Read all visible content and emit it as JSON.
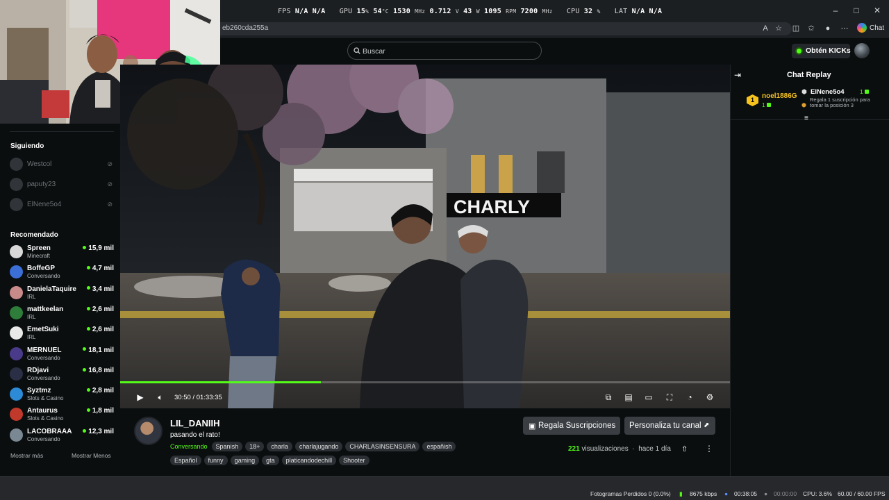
{
  "perf_overlay": {
    "fps_label": "FPS",
    "fps_values": "N/A N/A",
    "gpu_label": "GPU",
    "gpu_load": "15",
    "gpu_load_unit": "%",
    "gpu_temp": "54",
    "gpu_temp_unit": "°C",
    "gpu_clock": "1530",
    "gpu_clock_unit": "MHz",
    "gpu_voltage": "0.712",
    "gpu_voltage_unit": "V",
    "gpu_power": "43",
    "gpu_power_unit": "W",
    "fan_rpm": "1095",
    "fan_rpm_unit": "RPM",
    "mem_clock": "7200",
    "mem_clock_unit": "MHz",
    "cpu_label": "CPU",
    "cpu_load": "32",
    "cpu_load_unit": "%",
    "lat_label": "LAT",
    "lat_values": "N/A N/A"
  },
  "browser": {
    "url": "eb260cda255a",
    "chat_label": "Chat"
  },
  "header": {
    "search_placeholder": "Buscar",
    "kicks_button": "Obtén KICKs"
  },
  "video_overlay_text": {
    "shop_sign": "CHARLY"
  },
  "sidebar": {
    "following_title": "Siguiendo",
    "following": [
      {
        "name": "Westcol"
      },
      {
        "name": "paputy23"
      },
      {
        "name": "ElNene5o4"
      }
    ],
    "recommended_title": "Recomendado",
    "recommended": [
      {
        "name": "Spreen",
        "category": "Minecraft",
        "viewers": "15,9 mil",
        "color": "#d8d8d8"
      },
      {
        "name": "BoffeGP",
        "category": "Conversando",
        "viewers": "4,7 mil",
        "color": "#3b6fd6"
      },
      {
        "name": "DanielaTaquire",
        "category": "IRL",
        "viewers": "3,4 mil",
        "color": "#c98a8a"
      },
      {
        "name": "mattkeelan",
        "category": "IRL",
        "viewers": "2,6 mil",
        "color": "#2e7d3a"
      },
      {
        "name": "EmetSuki",
        "category": "IRL",
        "viewers": "2,6 mil",
        "color": "#e9e9e9"
      },
      {
        "name": "MERNUEL",
        "category": "Conversando",
        "viewers": "18,1 mil",
        "color": "#4a3a8a"
      },
      {
        "name": "RDjavi",
        "category": "Conversando",
        "viewers": "16,8 mil",
        "color": "#2a2f45"
      },
      {
        "name": "Syztmz",
        "category": "Slots & Casino",
        "viewers": "2,8 mil",
        "color": "#2c8ad6"
      },
      {
        "name": "Antaurus",
        "category": "Slots & Casino",
        "viewers": "1,8 mil",
        "color": "#c0392b"
      },
      {
        "name": "LACOBRAAA",
        "category": "Conversando",
        "viewers": "12,3 mil",
        "color": "#7a8894"
      }
    ],
    "show_more": "Mostrar más",
    "show_less": "Mostrar Menos"
  },
  "player": {
    "current_time": "30:50",
    "separator": "/",
    "duration": "01:33:35",
    "progress_fraction": 0.329
  },
  "stream_info": {
    "channel": "LIL_DANIIH",
    "title": "pasando el rato!",
    "category": "Conversando",
    "tags_row1": [
      "Spanish",
      "18+",
      "charla",
      "charlajugando",
      "CHARLASINSENSURA",
      "españish"
    ],
    "tags_row2": [
      "Español",
      "funny",
      "gaming",
      "gta",
      "platicandodechill",
      "Shooter"
    ],
    "gift_button": "Regala Suscripciones",
    "customize_button": "Personaliza tu canal",
    "views_count": "221",
    "views_label": "visualizaciones",
    "posted": "hace 1 día"
  },
  "chat": {
    "title": "Chat Replay",
    "gifter": {
      "badge": "1",
      "name": "noel1886G",
      "sub_badge": "1"
    },
    "message": {
      "user": "ElNene5o4",
      "count": "1",
      "text": "Regala 1 suscripción para tomar la posición",
      "position": "3"
    }
  },
  "obs_status": {
    "dropped_frames": "Fotogramas Perdidos 0 (0.0%)",
    "bitrate": "8675 kbps",
    "stream_time": "00:38:05",
    "rec_time": "00:00:00",
    "cpu": "CPU: 3.6%",
    "fps": "60.00 / 60.00 FPS"
  }
}
